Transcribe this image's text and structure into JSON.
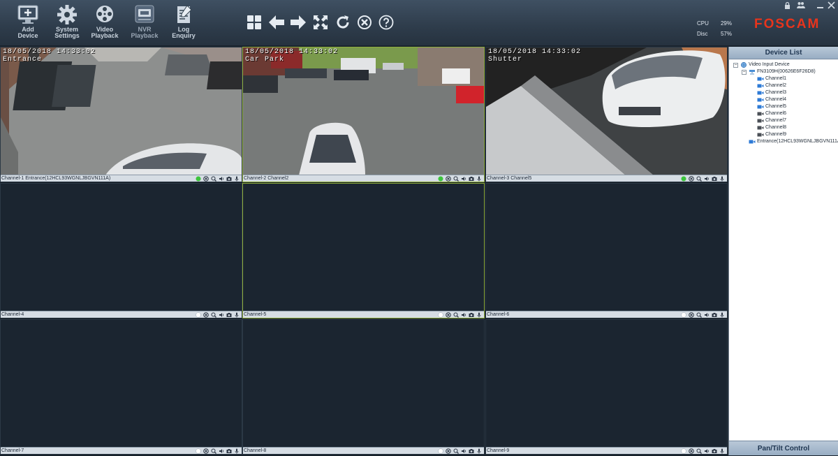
{
  "toolbar": {
    "buttons": [
      {
        "label": "Add Device",
        "icon": "add-device-icon"
      },
      {
        "label": "System Settings",
        "icon": "gear-icon"
      },
      {
        "label": "Video Playback",
        "icon": "film-reel-icon"
      },
      {
        "label": "NVR Playback",
        "icon": "nvr-icon"
      },
      {
        "label": "Log Enquiry",
        "icon": "log-document-icon"
      }
    ],
    "nav_icons": [
      "grid-layout-icon",
      "arrow-left-icon",
      "arrow-right-icon",
      "fullscreen-icon",
      "refresh-icon",
      "close-all-icon",
      "help-icon"
    ]
  },
  "system": {
    "cpu_label": "CPU",
    "cpu_value": "29%",
    "disc_label": "Disc",
    "disc_value": "57%"
  },
  "brand": {
    "logo": "FOSCAM",
    "color": "#e8341c"
  },
  "channels": [
    {
      "bar": "Channel-1  Entrance(12HCL93WGNLJBGVN111A)",
      "osd_time": "18/05/2018 14:33:02",
      "osd_name": "Entrance",
      "live": true
    },
    {
      "bar": "Channel-2  Channel2",
      "osd_time": "18/05/2018 14:33:02",
      "osd_name": "Car Park",
      "live": true
    },
    {
      "bar": "Channel-3  Channel5",
      "osd_time": "18/05/2018 14:33:02",
      "osd_name": "Shutter",
      "live": true
    },
    {
      "bar": "Channel-4",
      "live": false
    },
    {
      "bar": "Channel-5",
      "live": false
    },
    {
      "bar": "Channel-6",
      "live": false
    },
    {
      "bar": "Channel-7",
      "live": false
    },
    {
      "bar": "Channel-8",
      "live": false
    },
    {
      "bar": "Channel-9",
      "live": false
    }
  ],
  "status_colors": {
    "live": "#3cc43c",
    "idle": "#e8eef4"
  },
  "device_list": {
    "title": "Device List",
    "root": "Video Input Device",
    "nvr": "FN3109H(00626E6F26D8)",
    "nvr_channels": [
      "Channel1",
      "Channel2",
      "Channel3",
      "Channel4",
      "Channel5",
      "Channel6",
      "Channel7",
      "Channel8",
      "Channel9"
    ],
    "camera": "Entrance(12HCL93WGNLJBGVN111A)"
  },
  "ptz": {
    "label": "Pan/Tilt Control"
  }
}
